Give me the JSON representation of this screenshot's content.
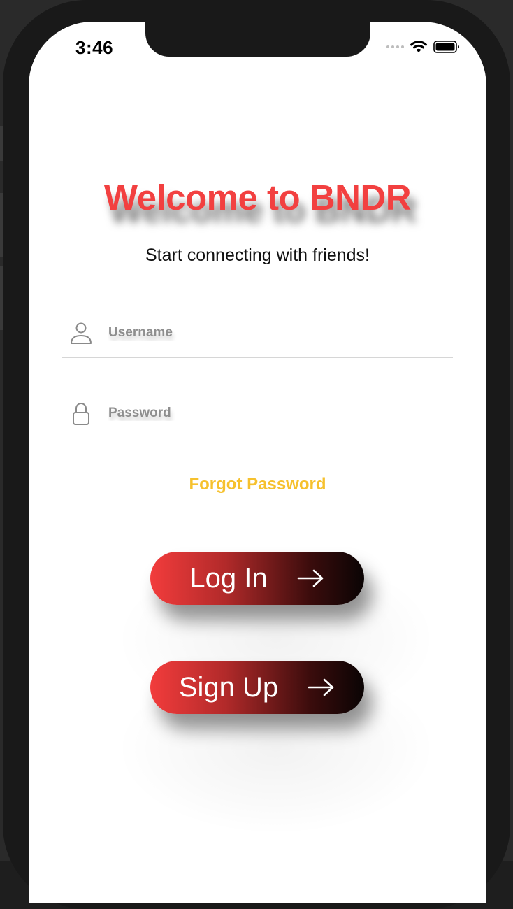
{
  "status_bar": {
    "time": "3:46",
    "signal_icon": "signal-dots-icon",
    "wifi_icon": "wifi-icon",
    "battery_icon": "battery-icon"
  },
  "main": {
    "title": "Welcome to BNDR",
    "subtitle": "Start connecting with friends!",
    "username": {
      "placeholder": "Username",
      "value": "",
      "icon": "person-icon"
    },
    "password": {
      "placeholder": "Password",
      "value": "",
      "icon": "lock-icon"
    },
    "forgot_password_label": "Forgot Password",
    "login_button_label": "Log In",
    "signup_button_label": "Sign Up",
    "arrow_icon": "arrow-right-icon"
  },
  "colors": {
    "title": "#f24040",
    "accent_yellow": "#f6c12e",
    "button_gradient_start": "#f23c3c",
    "button_gradient_end": "#0a0404",
    "device_bezel": "#191919"
  }
}
